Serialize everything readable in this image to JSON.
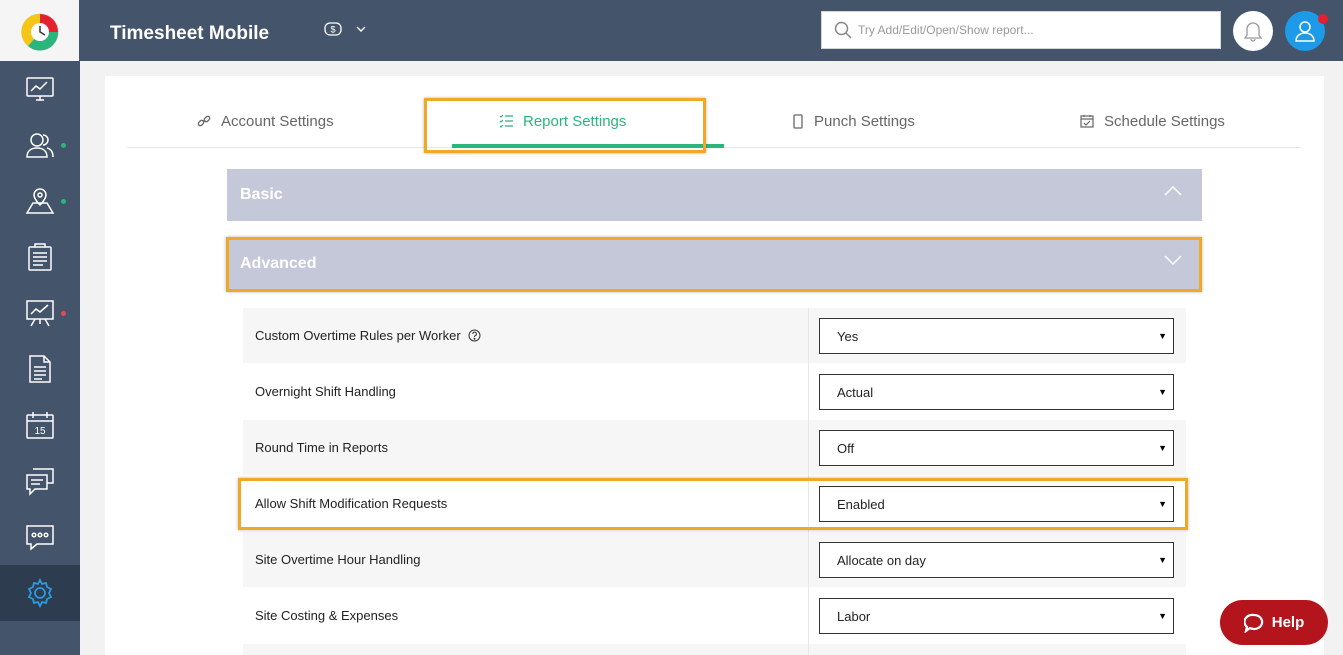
{
  "app": {
    "title": "Timesheet Mobile"
  },
  "header": {
    "currency_icon": "currency-icon",
    "search_placeholder": "Try Add/Edit/Open/Show report..."
  },
  "sidebar": {
    "items": [
      {
        "name": "dashboard",
        "icon": "monitor-chart-icon",
        "dot": null
      },
      {
        "name": "workers",
        "icon": "users-icon",
        "dot": "#2bb57c"
      },
      {
        "name": "sites",
        "icon": "map-pin-icon",
        "dot": "#2bb57c"
      },
      {
        "name": "timesheets",
        "icon": "clipboard-icon",
        "dot": null
      },
      {
        "name": "reports",
        "icon": "presentation-chart-icon",
        "dot": "#e5495c"
      },
      {
        "name": "documents",
        "icon": "document-icon",
        "dot": null
      },
      {
        "name": "schedule",
        "icon": "calendar-icon",
        "dot": null,
        "calendar_day": "15"
      },
      {
        "name": "messages",
        "icon": "chat-icon",
        "dot": null
      },
      {
        "name": "sms",
        "icon": "sms-bubble-icon",
        "dot": null
      },
      {
        "name": "settings",
        "icon": "gear-icon",
        "dot": null,
        "active": true
      }
    ]
  },
  "tabs": [
    {
      "label": "Account Settings",
      "icon": "link-icon"
    },
    {
      "label": "Report Settings",
      "icon": "checklist-icon",
      "active": true
    },
    {
      "label": "Punch Settings",
      "icon": "phone-icon"
    },
    {
      "label": "Schedule Settings",
      "icon": "calendar-icon"
    }
  ],
  "sections": {
    "basic": {
      "label": "Basic",
      "state": "expanded"
    },
    "advanced": {
      "label": "Advanced",
      "state": "collapsed"
    }
  },
  "settings": [
    {
      "label": "Custom Overtime Rules per Worker",
      "value": "Yes",
      "info": true
    },
    {
      "label": "Overnight Shift Handling",
      "value": "Actual"
    },
    {
      "label": "Round Time in Reports",
      "value": "Off"
    },
    {
      "label": "Allow Shift Modification Requests",
      "value": "Enabled"
    },
    {
      "label": "Site Overtime Hour Handling",
      "value": "Allocate on day"
    },
    {
      "label": "Site Costing & Expenses",
      "value": "Labor"
    }
  ],
  "help": {
    "label": "Help"
  },
  "colors": {
    "sidebar": "#44546a",
    "accent_green": "#2bb57c",
    "highlight": "#f0a826",
    "section_bg": "#c5c8d9",
    "help_bg": "#b4151c",
    "avatar_bg": "#1e9be8"
  }
}
